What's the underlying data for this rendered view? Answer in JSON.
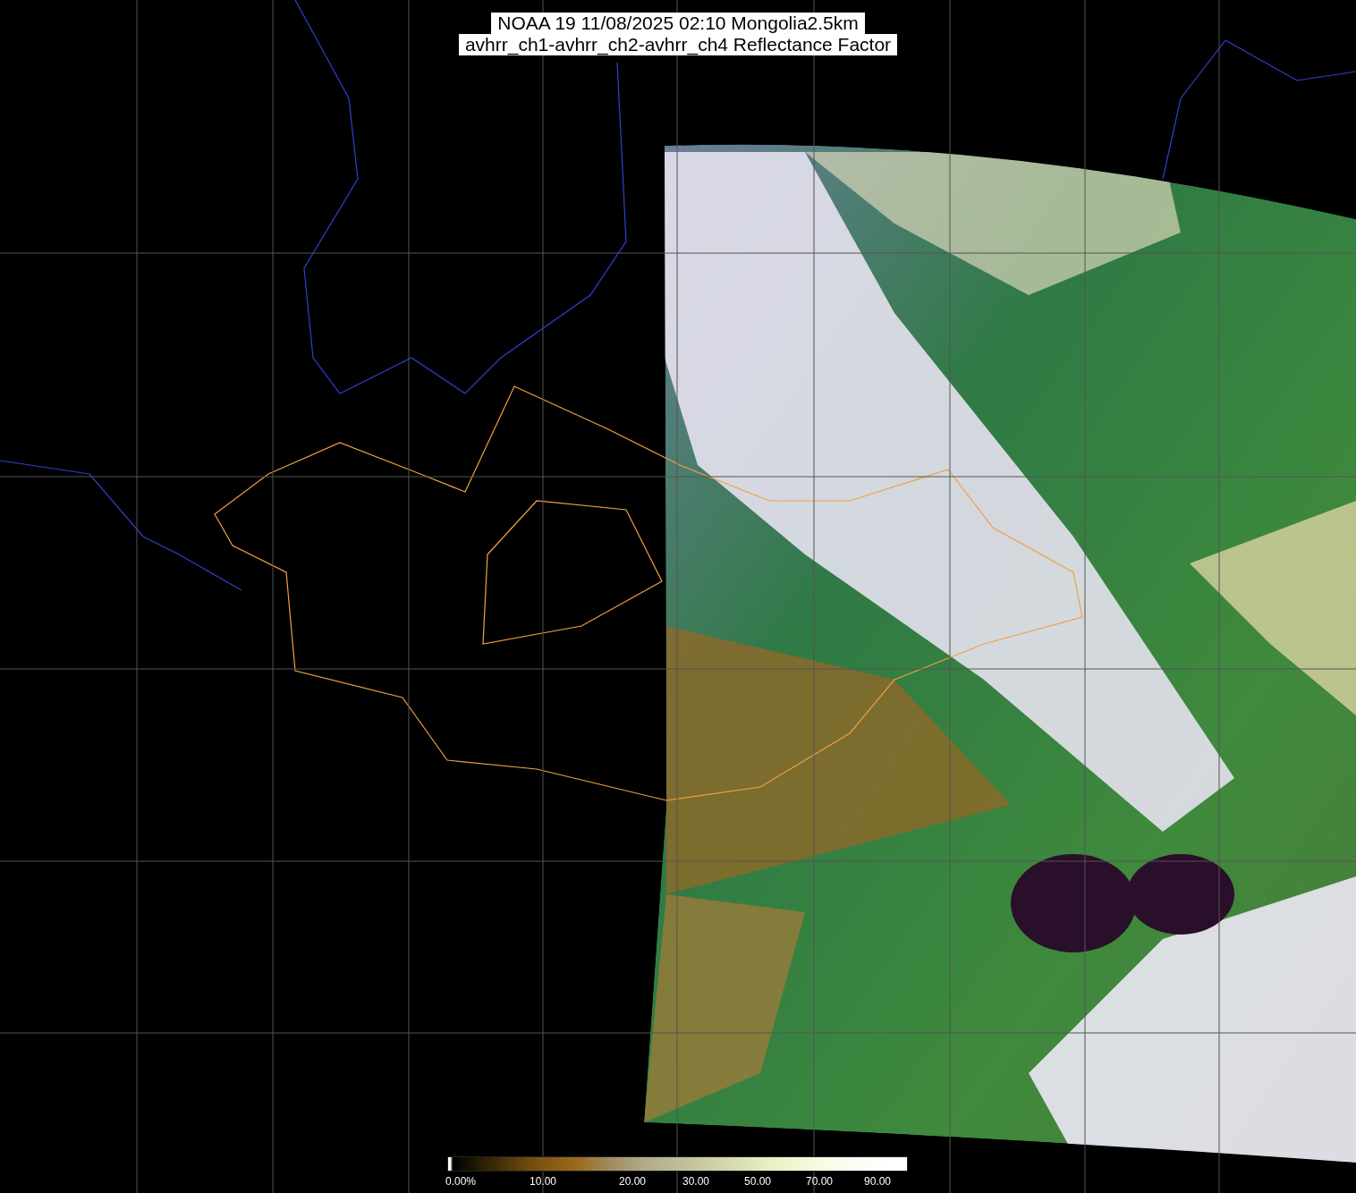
{
  "title": {
    "lines": [
      "NOAA 19 11/08/2025 02:10 Mongolia2.5km",
      "avhrr_ch1-avhrr_ch2-avhrr_ch4 Reflectance Factor"
    ]
  },
  "colorbar": {
    "labels": [
      "0.00%",
      "10.00",
      "20.00",
      "30.00",
      "50.00",
      "70.00",
      "90.00"
    ]
  }
}
